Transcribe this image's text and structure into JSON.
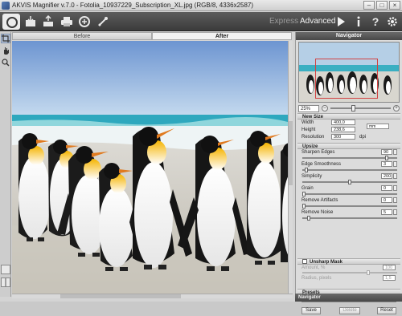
{
  "window": {
    "title": "AKVIS Magnifier v.7.0 - Fotolia_10937229_Subscription_XL.jpg (RGB/8, 4336x2587)",
    "controls": [
      "–",
      "□",
      "×"
    ]
  },
  "toolbar": {
    "buttons": [
      "open-image-icon",
      "save-image-icon",
      "print-icon",
      "batch-icon",
      "settings-plugin-icon"
    ],
    "mode_express": "Express",
    "mode_advanced": "Advanced",
    "right_icons": [
      "run-icon",
      "info-icon",
      "help-icon",
      "gear-icon"
    ]
  },
  "canvas": {
    "tab_before": "Before",
    "tab_after": "After",
    "active_tab": "After"
  },
  "navigator": {
    "title": "Navigator",
    "zoom": "25%",
    "zoom_level": 0.35
  },
  "new_size": {
    "title": "New Size",
    "width_label": "Width",
    "width_value": "400,0",
    "height_label": "Height",
    "height_value": "238,6",
    "unit": "mm",
    "resolution_label": "Resolution",
    "resolution_value": "300",
    "resolution_unit": "dpi"
  },
  "upsize": {
    "title": "Upsize",
    "params": [
      {
        "label": "Sharpen Edges",
        "value": "90",
        "level": 0.9
      },
      {
        "label": "Edge Smoothness",
        "value": "3",
        "level": 0.03
      },
      {
        "label": "Simplicity",
        "value": "200",
        "level": 0.5
      },
      {
        "label": "Grain",
        "value": "0",
        "level": 0.0
      },
      {
        "label": "Remove Artifacts",
        "value": "0",
        "level": 0.0
      },
      {
        "label": "Remove Noise",
        "value": "5",
        "level": 0.05
      }
    ]
  },
  "unsharp": {
    "title": "Unsharp Mask",
    "amount_label": "Amount, %",
    "amount_value": "100",
    "radius_label": "Radius, pixels",
    "radius_value": "1,5"
  },
  "presets": {
    "title": "Presets",
    "save": "Save",
    "delete": "Delete",
    "reset": "Reset"
  },
  "footer": {
    "navigator": "Navigator"
  },
  "colors": {
    "toolbar": "#474747",
    "panel": "#dcdcdc",
    "sky": "#a8c8e6",
    "sea": "#37b3c6"
  }
}
